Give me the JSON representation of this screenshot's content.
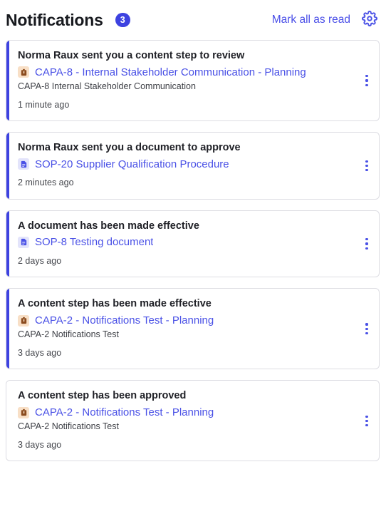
{
  "header": {
    "title": "Notifications",
    "badge_count": "3",
    "mark_all_label": "Mark all as read",
    "settings_icon": "gear-icon",
    "accent_color": "#3d42e0",
    "link_color": "#4a4fe8"
  },
  "notifications": [
    {
      "title": "Norma Raux sent you a content step to review",
      "link": "CAPA-8 - Internal Stakeholder Communication - Planning",
      "icon": "capa-icon",
      "subtitle": "CAPA-8 Internal Stakeholder Communication",
      "time": "1 minute ago",
      "unread": true,
      "menu_icon": "kebab-menu-icon"
    },
    {
      "title": "Norma Raux sent you a document to approve",
      "link": "SOP-20 Supplier Qualification Procedure",
      "icon": "document-icon",
      "subtitle": "",
      "time": "2 minutes ago",
      "unread": true,
      "menu_icon": "kebab-menu-icon"
    },
    {
      "title": "A document has been made effective",
      "link": "SOP-8 Testing document",
      "icon": "document-icon",
      "subtitle": "",
      "time": "2 days ago",
      "unread": true,
      "menu_icon": "kebab-menu-icon"
    },
    {
      "title": "A content step has been made effective",
      "link": "CAPA-2 - Notifications Test - Planning",
      "icon": "capa-icon",
      "subtitle": "CAPA-2 Notifications Test",
      "time": "3 days ago",
      "unread": true,
      "menu_icon": "kebab-menu-icon"
    },
    {
      "title": "A content step has been approved",
      "link": "CAPA-2 - Notifications Test - Planning",
      "icon": "capa-icon",
      "subtitle": "CAPA-2 Notifications Test",
      "time": "3 days ago",
      "unread": false,
      "menu_icon": "kebab-menu-icon"
    }
  ]
}
